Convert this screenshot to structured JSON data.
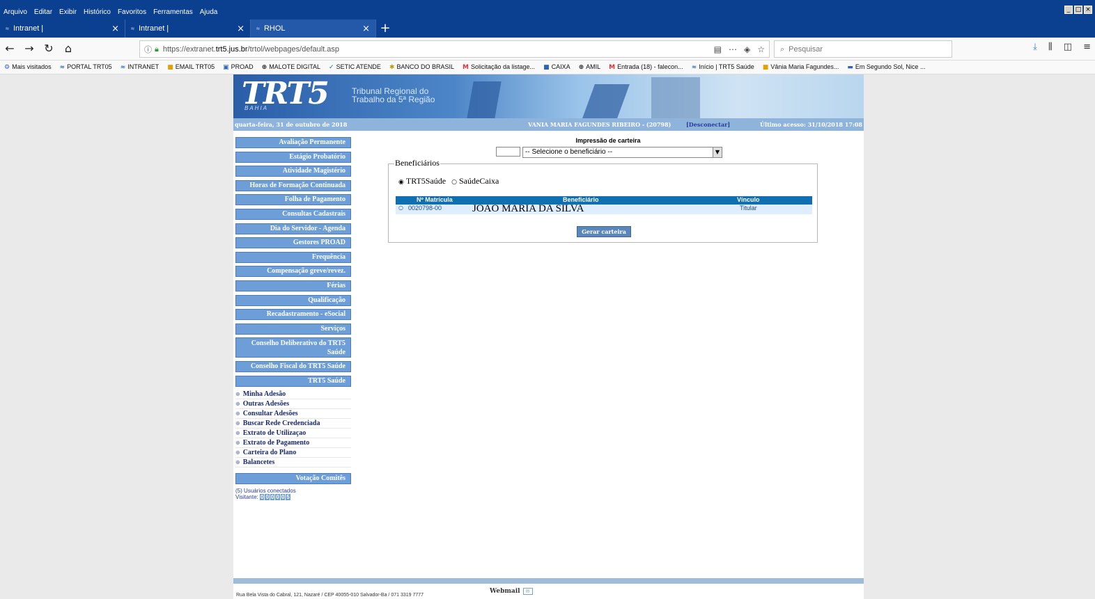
{
  "menubar": [
    "Arquivo",
    "Editar",
    "Exibir",
    "Histórico",
    "Favoritos",
    "Ferramentas",
    "Ajuda"
  ],
  "window_controls": [
    "_",
    "□",
    "×"
  ],
  "tabs": [
    {
      "title": "Intranet |",
      "close": "×"
    },
    {
      "title": "Intranet |",
      "close": "×"
    },
    {
      "title": "RHOL",
      "close": "×"
    }
  ],
  "new_tab": "+",
  "url": {
    "prefix": "https://extranet.",
    "host": "trt5.jus.br",
    "path": "/trtol/webpages/default.asp"
  },
  "search_placeholder": "Pesquisar",
  "bookmarks": [
    "Mais visitados",
    "PORTAL TRT05",
    "INTRANET",
    "EMAIL TRT05",
    "PROAD",
    "MALOTE DIGITAL",
    "SETIC ATENDE",
    "BANCO DO BRASIL",
    "Solicitação da listage...",
    "CAIXA",
    "AMIL",
    "Entrada (18) - falecon...",
    "Início | TRT5 Saúde",
    "Vânia Maria Fagundes...",
    "Em Segundo Sol, Nice ..."
  ],
  "banner": {
    "logo": "TRT5",
    "logo_sub": "BAHIA",
    "line1": "Tribunal Regional do",
    "line2": "Trabalho da 5ª Região"
  },
  "infobar": {
    "date": "quarta-feira, 31 de outubro de 2018",
    "user": "VANIA MARIA FAGUNDES RIBEIRO - (20798)",
    "disconnect": "[Desconectar]",
    "last_access": "Último acesso: 31/10/2018 17:08"
  },
  "sidebar": {
    "items": [
      "Avaliação Permanente",
      "Estágio Probatório",
      "Atividade Magistério",
      "Horas de Formação Continuada",
      "Folha de Pagamento",
      "Consultas Cadastrais",
      "Dia do Servidor - Agenda",
      "Gestores PROAD",
      "Frequência",
      "Compensação greve/revez.",
      "Férias",
      "Qualificação",
      "Recadastramento - eSocial",
      "Serviços",
      "Conselho Deliberativo do TRT5 Saúde",
      "Conselho Fiscal do TRT5 Saúde",
      "TRT5 Saúde"
    ],
    "subitems": [
      "Minha Adesão",
      "Outras Adesões",
      "Consultar Adesões",
      "Buscar Rede Credenciada",
      "Extrato de Utilizaçao",
      "Extrato de Pagamento",
      "Carteira do Plano",
      "Balancetes"
    ],
    "votacao": "Votação Comitês",
    "users_connected": "(5) Usuários conectados",
    "visitor_label": "Visitante:",
    "visitor_digits": [
      "0",
      "0",
      "0",
      "0",
      "0",
      "5"
    ]
  },
  "main": {
    "title": "Impressão de carteira",
    "select_value": "-- Selecione o beneficiário --",
    "fieldset_legend": "Beneficiários",
    "radio1": "TRT5Saúde",
    "radio2": "SaúdeCaixa",
    "columns": [
      "Nº Matrícula",
      "Beneficiário",
      "Vínculo"
    ],
    "row": {
      "matricula": "0020798-00",
      "nome": "JOAO MARIA DA SILVA",
      "vinculo": "Titular"
    },
    "button": "Gerar carteira"
  },
  "footer": {
    "address": "Rua Bela Vista do Cabral, 121, Nazaré / CEP 40055-010 Salvador-Ba / 071 3319 7777",
    "webmail": "Webmail"
  },
  "colors": {
    "accent": "#6d9ed8",
    "header_blue": "#0f6fb0",
    "titlebar": "#0b3f8f"
  }
}
